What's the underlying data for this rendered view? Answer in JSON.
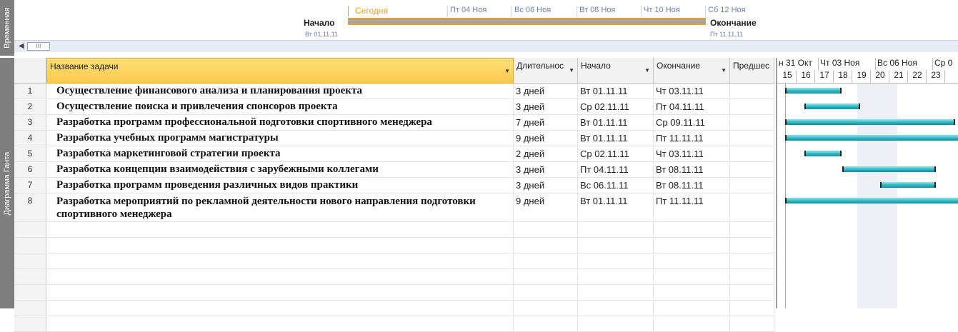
{
  "side": {
    "timeline_label": "Временная",
    "gantt_label": "Диаграмма Ганта"
  },
  "timeline": {
    "today": "Сегодня",
    "ticks": [
      "Пт 04 Ноя",
      "Вс 06 Ноя",
      "Вт 08 Ноя",
      "Чт 10 Ноя",
      "Сб 12 Ноя"
    ],
    "start_label": "Начало",
    "start_date": "Вт 01.11.11",
    "end_label": "Окончание",
    "end_date": "Пт 11.11.11",
    "scroll_thumb": "III"
  },
  "columns": {
    "name": "Название задачи",
    "duration": "Длительнос",
    "start": "Начало",
    "finish": "Окончание",
    "pred": "Предшес"
  },
  "tasks": [
    {
      "id": "1",
      "name": "Осуществление финансового анализа и планирования проекта",
      "duration": "3 дней",
      "start": "Вт 01.11.11",
      "finish": "Чт 03.11.11",
      "startDay": 1,
      "days": 3
    },
    {
      "id": "2",
      "name": "Осуществление поиска и привлечения спонсоров проекта",
      "duration": "3 дней",
      "start": "Ср 02.11.11",
      "finish": "Пт 04.11.11",
      "startDay": 2,
      "days": 3
    },
    {
      "id": "3",
      "name": "Разработка программ профессиональной подготовки спортивного менеджера",
      "duration": "7 дней",
      "start": "Вт 01.11.11",
      "finish": "Ср 09.11.11",
      "startDay": 1,
      "days": 9
    },
    {
      "id": "4",
      "name": "Разработка учебных программ магистратуры",
      "duration": "9 дней",
      "start": "Вт 01.11.11",
      "finish": "Пт 11.11.11",
      "startDay": 1,
      "days": 11
    },
    {
      "id": "5",
      "name": "Разработка маркетинговой стратегии проекта",
      "duration": "2 дней",
      "start": "Ср 02.11.11",
      "finish": "Чт 03.11.11",
      "startDay": 2,
      "days": 2
    },
    {
      "id": "6",
      "name": "Разработка концепции взаимодействия с зарубежными коллегами",
      "duration": "3 дней",
      "start": "Пт 04.11.11",
      "finish": "Вт 08.11.11",
      "startDay": 4,
      "days": 5
    },
    {
      "id": "7",
      "name": "Разработка программ проведения различных видов практики",
      "duration": "3 дней",
      "start": "Вс 06.11.11",
      "finish": "Вт 08.11.11",
      "startDay": 6,
      "days": 3
    },
    {
      "id": "8",
      "name": "Разработка мероприятий по рекламной деятельности нового направления подготовки спортивного менеджера",
      "duration": "9 дней",
      "start": "Вт 01.11.11",
      "finish": "Пт 11.11.11",
      "startDay": 1,
      "days": 11
    }
  ],
  "gantt": {
    "weeks": [
      "н 31 Окт",
      "Чт 03 Ноя",
      "Вс 06 Ноя",
      "Ср 0"
    ],
    "days": [
      "15",
      "16",
      "17",
      "18",
      "19",
      "20",
      "21",
      "22",
      "23"
    ]
  },
  "colors": {
    "bar": "#27b1be",
    "header_active": "#fcc94a",
    "today": "#f3a019"
  }
}
